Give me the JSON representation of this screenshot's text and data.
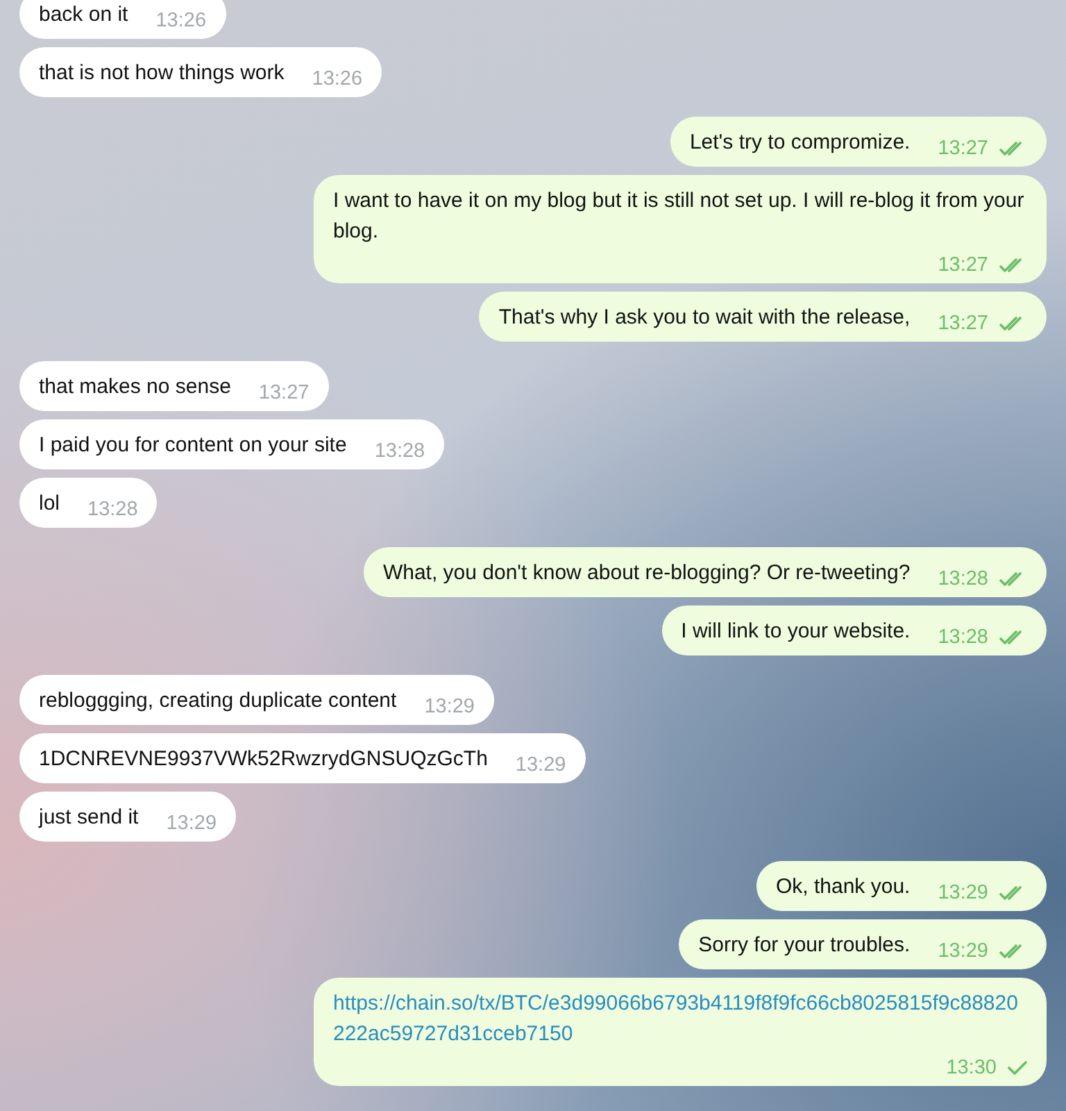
{
  "messages": [
    {
      "outgoing": false,
      "kind": "text",
      "text": "back on it",
      "time": "13:26"
    },
    {
      "outgoing": false,
      "kind": "text",
      "text": "that is not how things work",
      "time": "13:26"
    },
    {
      "outgoing": true,
      "kind": "text",
      "text": "Let's try to compromize.",
      "time": "13:27",
      "read": true
    },
    {
      "outgoing": true,
      "kind": "text",
      "text": "I want to have it on my blog but it is still not set up. I will re-blog it from your blog.",
      "time": "13:27",
      "read": true
    },
    {
      "outgoing": true,
      "kind": "text",
      "text": "That's why I ask you to wait with the release,",
      "time": "13:27",
      "read": true
    },
    {
      "outgoing": false,
      "kind": "text",
      "text": "that makes no sense",
      "time": "13:27"
    },
    {
      "outgoing": false,
      "kind": "text",
      "text": "I paid you for content on your site",
      "time": "13:28"
    },
    {
      "outgoing": false,
      "kind": "text",
      "text": "lol",
      "time": "13:28"
    },
    {
      "outgoing": true,
      "kind": "text",
      "text": "What, you don't know about re-blogging? Or re-tweeting?",
      "time": "13:28",
      "read": true
    },
    {
      "outgoing": true,
      "kind": "text",
      "text": "I will link to your website.",
      "time": "13:28",
      "read": true
    },
    {
      "outgoing": false,
      "kind": "text",
      "text": "rebloggging, creating duplicate content",
      "time": "13:29"
    },
    {
      "outgoing": false,
      "kind": "text",
      "text": "1DCNREVNE9937VWk52RwzrydGNSUQzGcTh",
      "time": "13:29"
    },
    {
      "outgoing": false,
      "kind": "text",
      "text": "just send it",
      "time": "13:29"
    },
    {
      "outgoing": true,
      "kind": "text",
      "text": "Ok, thank you.",
      "time": "13:29",
      "read": true
    },
    {
      "outgoing": true,
      "kind": "text",
      "text": "Sorry for your troubles.",
      "time": "13:29",
      "read": true
    },
    {
      "outgoing": true,
      "kind": "link",
      "text": "https://chain.so/tx/BTC/e3d99066b6793b4119f8f9fc66cb8025815f9c88820222ac59727d31cceb7150",
      "time": "13:30",
      "read": false
    }
  ]
}
